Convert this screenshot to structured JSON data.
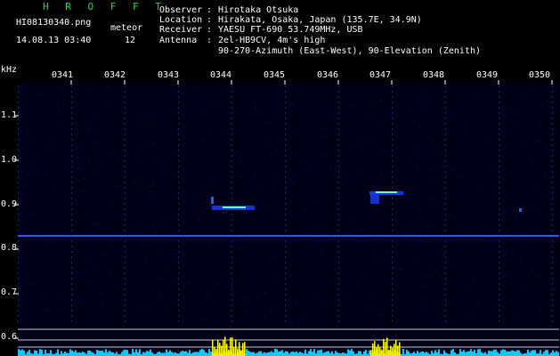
{
  "app": {
    "title": "H R O F F T"
  },
  "header": {
    "filename": "HI08130340.png",
    "datetime": "14.08.13 03:40",
    "meteor_label": "meteor",
    "meteor_count": "12",
    "info_keys": [
      "Observer",
      "Location",
      "Receiver",
      "Antenna",
      ""
    ],
    "info_values": [
      "Hirotaka Otsuka",
      "Hirakata, Osaka, Japan (135.7E, 34.9N)",
      "YAESU FT-690 53.749MHz, USB",
      "2el-HB9CV, 4m's high",
      "90-270-Azimuth (East-West), 90-Elevation (Zenith)"
    ]
  },
  "spectrogram": {
    "y_unit": "kHz",
    "time_labels": [
      "0341",
      "0342",
      "0343",
      "0344",
      "0345",
      "0346",
      "0347",
      "0348",
      "0349",
      "0350"
    ],
    "freq_labels": [
      "1.1",
      "1.0",
      "0.9",
      "0.8",
      "0.7",
      "0.6"
    ],
    "colors": {
      "background": "#000018",
      "carrier_line": "#3355ff",
      "echo": "#66ffcc",
      "activity": "#00ccff",
      "meteor_bars": "#ffff00",
      "grid": "#ffffff"
    }
  }
}
